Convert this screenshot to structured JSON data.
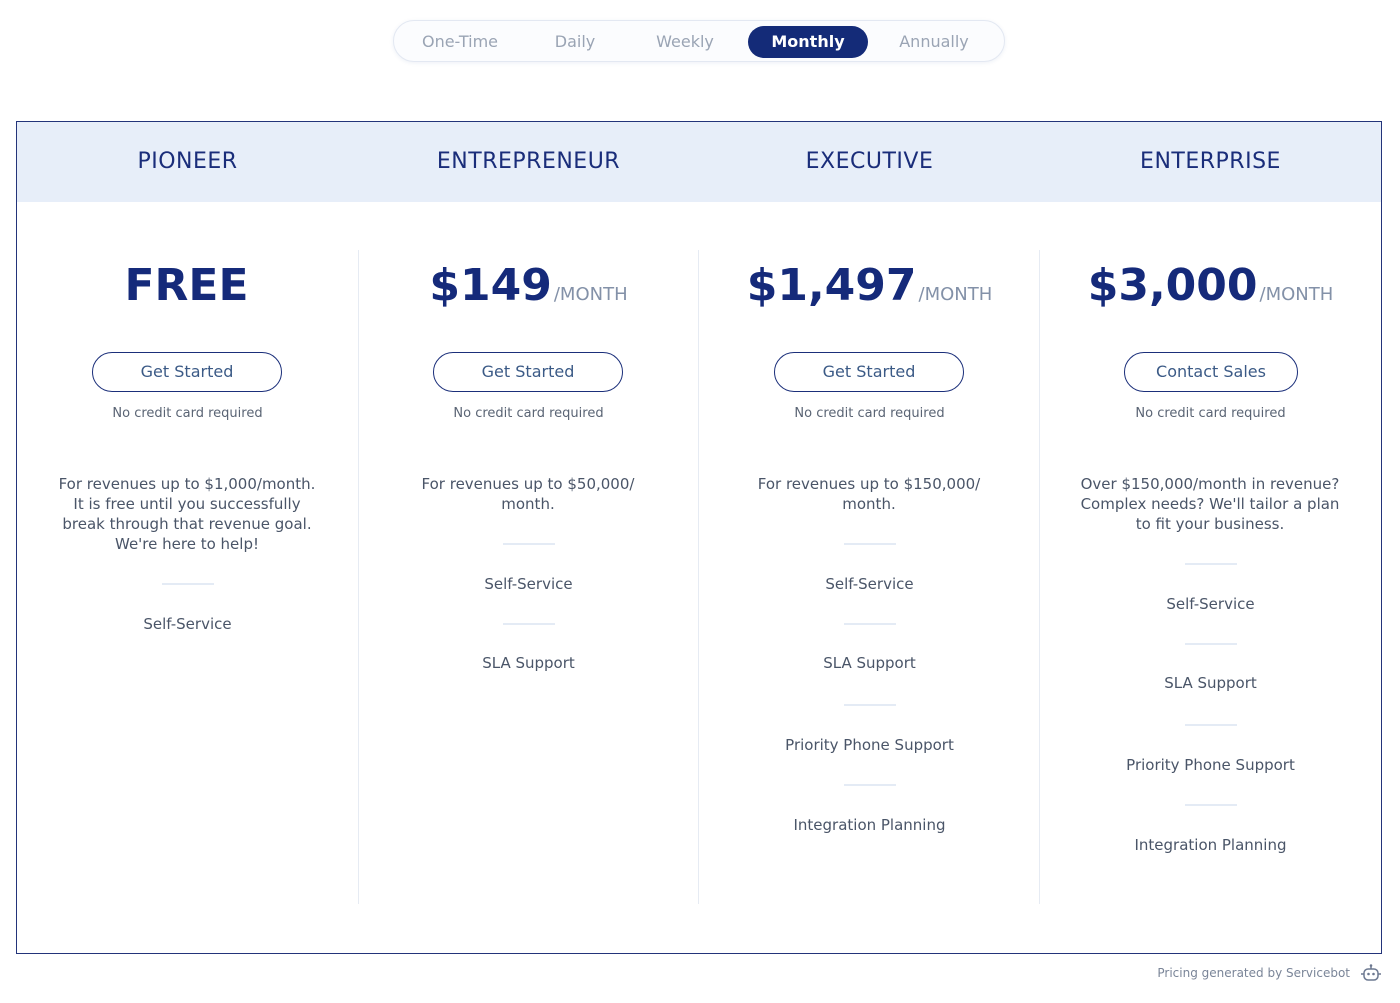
{
  "periods": {
    "options": [
      "One-Time",
      "Daily",
      "Weekly",
      "Monthly",
      "Annually"
    ],
    "selected": "Monthly"
  },
  "plans": [
    {
      "name": "PIONEER",
      "price": "FREE",
      "unit": "",
      "cta": "Get Started",
      "note": "No credit card required",
      "description": "For revenues up to $1,000/month. It is free until you successfully break through that revenue goal. We're here to help!",
      "features": [
        "Self-Service"
      ]
    },
    {
      "name": "ENTREPRENEUR",
      "price": "$149",
      "unit": "/MONTH",
      "cta": "Get Started",
      "note": "No credit card required",
      "description": "For revenues up to $50,000/ month.",
      "features": [
        "Self-Service",
        "SLA Support"
      ]
    },
    {
      "name": "EXECUTIVE",
      "price": "$1,497",
      "unit": "/MONTH",
      "cta": "Get Started",
      "note": "No credit card required",
      "description": "For revenues up to $150,000/ month.",
      "features": [
        "Self-Service",
        "SLA Support",
        "Priority Phone Support",
        "Integration Planning"
      ]
    },
    {
      "name": "ENTERPRISE",
      "price": "$3,000",
      "unit": "/MONTH",
      "cta": "Contact Sales",
      "note": "No credit card required",
      "description": "Over $150,000/month in revenue? Complex needs? We'll tailor a plan to fit your business.",
      "features": [
        "Self-Service",
        "SLA Support",
        "Priority Phone Support",
        "Integration Planning"
      ]
    }
  ],
  "footer": {
    "text": "Pricing generated by Servicebot",
    "icon": "robot-icon"
  },
  "colors": {
    "brand": "#142b78",
    "header_bg": "#e7eef9",
    "border": "#23347a"
  }
}
